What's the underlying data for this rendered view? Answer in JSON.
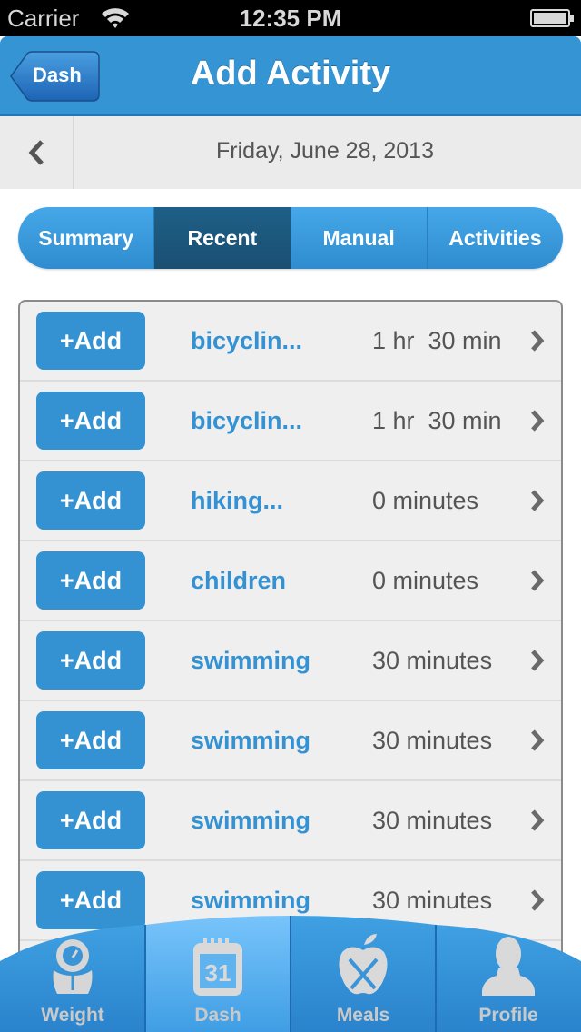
{
  "status_bar": {
    "carrier": "Carrier",
    "time": "12:35 PM"
  },
  "nav": {
    "back_label": "Dash",
    "title": "Add Activity"
  },
  "date_bar": {
    "date": "Friday, June 28, 2013"
  },
  "segments": [
    {
      "label": "Summary",
      "active": false
    },
    {
      "label": "Recent",
      "active": true
    },
    {
      "label": "Manual",
      "active": false
    },
    {
      "label": "Activities",
      "active": false
    }
  ],
  "add_label": "+Add",
  "activities": [
    {
      "name": "bicyclin...",
      "duration": "1 hr  30 min"
    },
    {
      "name": "bicyclin...",
      "duration": "1 hr  30 min"
    },
    {
      "name": "hiking...",
      "duration": "0 minutes"
    },
    {
      "name": "children",
      "duration": "0 minutes"
    },
    {
      "name": "swimming",
      "duration": "30 minutes"
    },
    {
      "name": "swimming",
      "duration": "30 minutes"
    },
    {
      "name": "swimming",
      "duration": "30 minutes"
    },
    {
      "name": "swimming",
      "duration": "30 minutes"
    }
  ],
  "tabs": [
    {
      "label": "Weight",
      "icon": "scale-icon",
      "active": false
    },
    {
      "label": "Dash",
      "icon": "calendar-icon",
      "active": true,
      "calendar_day": "31"
    },
    {
      "label": "Meals",
      "icon": "apple-utensils-icon",
      "active": false
    },
    {
      "label": "Profile",
      "icon": "person-icon",
      "active": false
    }
  ]
}
